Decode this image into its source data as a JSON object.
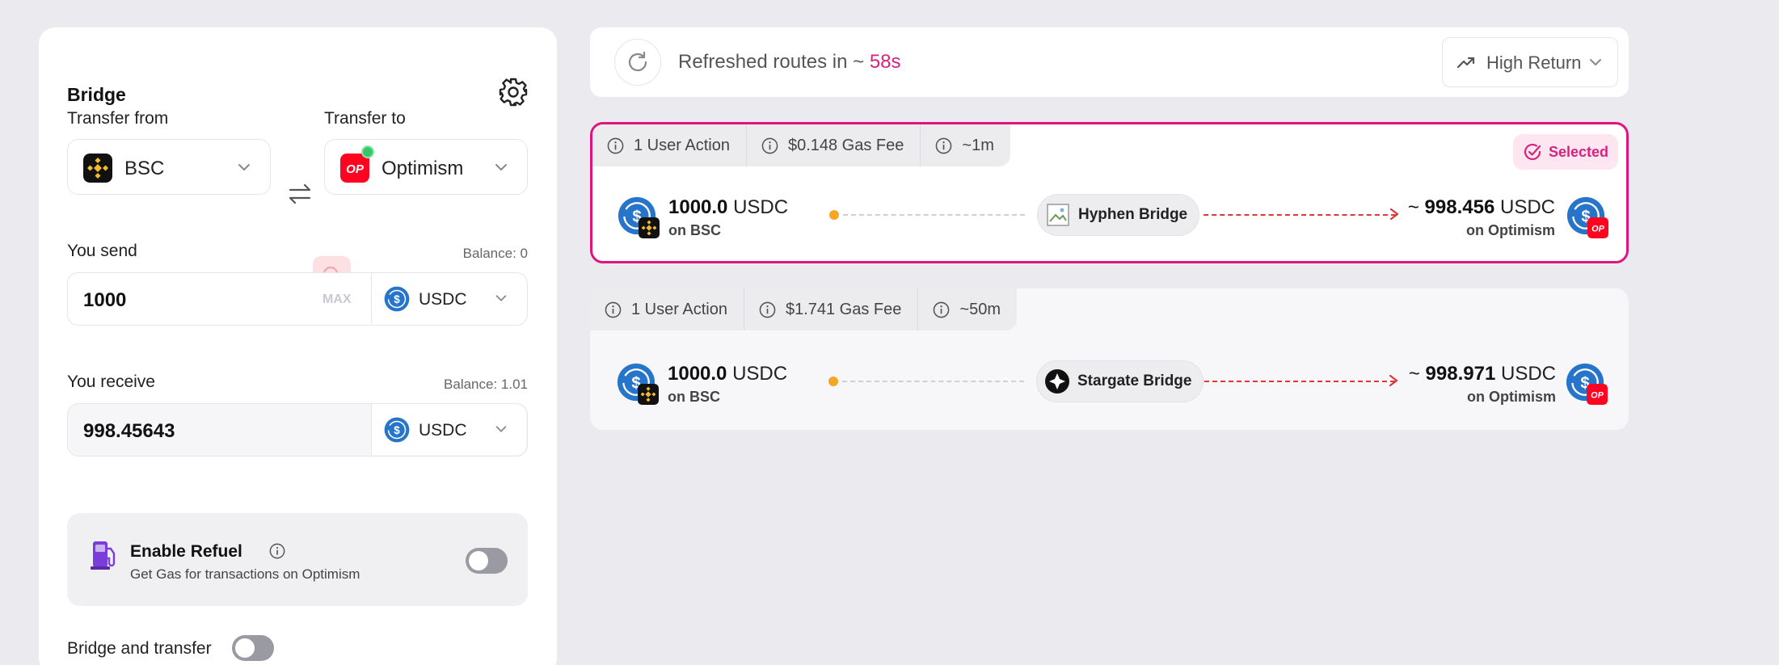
{
  "colors": {
    "accent": "#d6237e",
    "bsc": "#f3ba2f",
    "optimism": "#ff0420",
    "usdc": "#2775ca"
  },
  "bridge_panel": {
    "title": "Bridge",
    "transfer_from_label": "Transfer from",
    "transfer_to_label": "Transfer to",
    "from_chain": "BSC",
    "to_chain": "Optimism",
    "send": {
      "label": "You send",
      "balance": "Balance: 0",
      "amount": "1000",
      "max_label": "MAX",
      "token": "USDC"
    },
    "receive": {
      "label": "You receive",
      "balance": "Balance: 1.01",
      "amount": "998.45643",
      "token": "USDC"
    },
    "refuel": {
      "title": "Enable Refuel",
      "subtitle": "Get Gas for transactions on Optimism"
    },
    "bridge_and_transfer_label": "Bridge and transfer"
  },
  "topbar": {
    "refresh_prefix": "Refreshed routes in ~",
    "refresh_countdown": "58s",
    "sort_label": "High Return"
  },
  "routes": [
    {
      "tags": [
        "1 User Action",
        "$0.148 Gas Fee",
        "~1m"
      ],
      "selected_label": "Selected",
      "send_amount": "1000.0",
      "send_token": "USDC",
      "send_network": "on BSC",
      "bridge_name": "Hyphen Bridge",
      "receive_prefix": "~",
      "receive_amount": "998.456",
      "receive_token": "USDC",
      "receive_network": "on Optimism"
    },
    {
      "tags": [
        "1 User Action",
        "$1.741 Gas Fee",
        "~50m"
      ],
      "send_amount": "1000.0",
      "send_token": "USDC",
      "send_network": "on BSC",
      "bridge_name": "Stargate Bridge",
      "receive_prefix": "~",
      "receive_amount": "998.971",
      "receive_token": "USDC",
      "receive_network": "on Optimism"
    }
  ]
}
